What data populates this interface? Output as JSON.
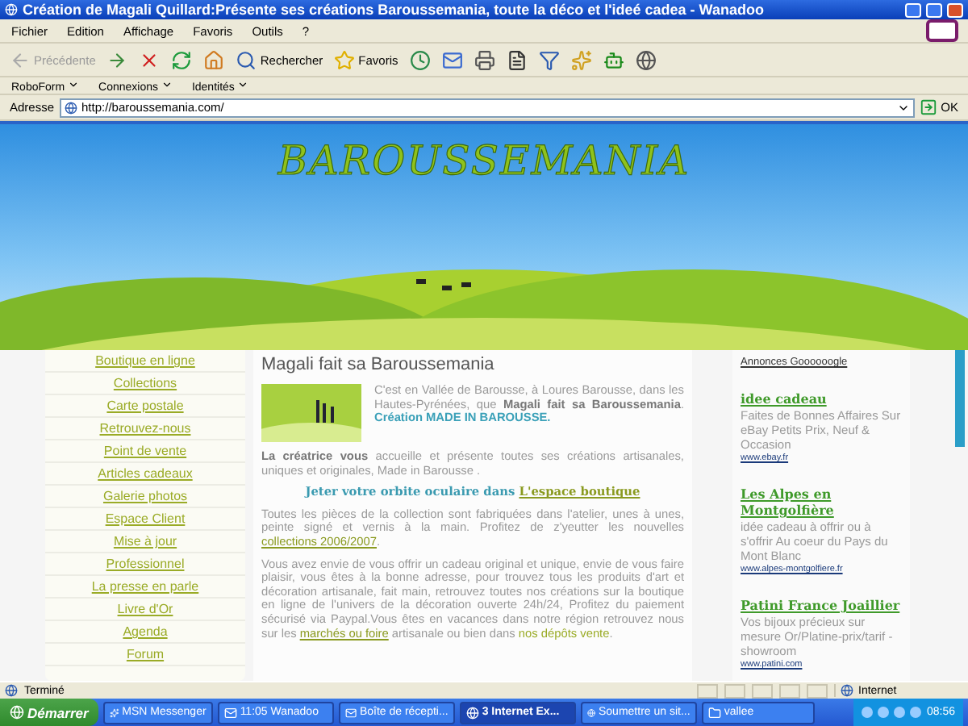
{
  "window": {
    "title": "Création de Magali Quillard:Présente ses créations Baroussemania, toute la déco et l'ideé cadea - Wanadoo"
  },
  "menu": [
    "Fichier",
    "Edition",
    "Affichage",
    "Favoris",
    "Outils",
    "?"
  ],
  "toolbar": [
    {
      "kind": "back",
      "label": "Précédente",
      "disabled": true
    },
    {
      "kind": "forward",
      "disabled": false
    },
    {
      "kind": "stop"
    },
    {
      "kind": "refresh"
    },
    {
      "kind": "home"
    },
    {
      "kind": "search",
      "label": "Rechercher"
    },
    {
      "kind": "favorites",
      "label": "Favoris"
    },
    {
      "kind": "history"
    },
    {
      "kind": "mail"
    },
    {
      "kind": "print"
    },
    {
      "kind": "edit"
    },
    {
      "kind": "filter"
    },
    {
      "kind": "messenger"
    },
    {
      "kind": "robot"
    },
    {
      "kind": "bag"
    }
  ],
  "links_bar": [
    "RoboForm",
    "Connexions",
    "Identités"
  ],
  "address": {
    "label": "Adresse",
    "value": "http://baroussemania.com/",
    "go": "OK"
  },
  "page": {
    "site_title": "BAROUSSEMANIA",
    "nav": [
      {
        "label": "Boutique en ligne"
      },
      {
        "label": "Collections"
      },
      {
        "label": "Carte postale"
      },
      {
        "label": "Retrouvez-nous"
      },
      {
        "label": "Point de vente"
      },
      {
        "label": "Articles cadeaux"
      },
      {
        "label": "Galerie photos"
      },
      {
        "label": "Espace Client"
      },
      {
        "label": "Mise à jour"
      },
      {
        "label": "Professionnel"
      },
      {
        "label": "La presse en parle"
      },
      {
        "label": "Livre d'Or"
      },
      {
        "label": "Agenda"
      },
      {
        "label": "Forum"
      }
    ],
    "heading": "Magali fait sa Baroussemania",
    "paragraphs": [
      [
        {
          "kind": "plain",
          "text": "C'est en Vallée de Barousse, à Loures Barousse, dans les Hautes-Pyrénées, que "
        },
        {
          "kind": "bold",
          "text": "Magali fait sa Baroussemania"
        },
        {
          "kind": "plain",
          "text": ". "
        },
        {
          "kind": "highlight",
          "text": "Création MADE IN BAROUSSE."
        }
      ],
      [
        {
          "kind": "bold",
          "text": "La créatrice vous"
        },
        {
          "kind": "plain",
          "text": " accueille et présente toutes ses créations artisanales, uniques et originales, Made in Barousse ."
        }
      ],
      [
        {
          "kind": "serif",
          "text": "Jeter votre orbite oculaire dans "
        },
        {
          "kind": "link",
          "text": "L'espace boutique"
        }
      ],
      [
        {
          "kind": "plain",
          "text": "Toutes les pièces de la collection sont fabriquées dans l'atelier, unes à unes, peinte signé et vernis à la main. Profitez de z'yeutter les nouvelles"
        },
        {
          "kind": "link",
          "text": " collections 2006/2007"
        },
        {
          "kind": "plain",
          "text": "."
        }
      ],
      [
        {
          "kind": "plain",
          "text": "Vous avez envie de vous offrir un cadeau original et unique, envie de vous faire plaisir, vous êtes à la bonne adresse, pour trouvez tous les produits d'art et décoration artisanale, fait main, retrouvez toutes nos créations sur la boutique en ligne de l'univers de la décoration ouverte 24h/24, Profitez du paiement sécurisé via Paypal.Vous êtes en vacances dans notre région retrouvez nous sur les "
        },
        {
          "kind": "link",
          "text": "marchés ou foire"
        },
        {
          "kind": "plain",
          "text": " artisanale ou bien dans "
        },
        {
          "kind": "highlight2",
          "text": "nos dépôts vente"
        },
        {
          "kind": "plain",
          "text": "."
        }
      ]
    ],
    "ads_title": "Annonces Goooooogle",
    "ads": [
      {
        "title": "idee cadeau",
        "text": "Faites de Bonnes Affaires Sur eBay Petits Prix, Neuf & Occasion",
        "url": "www.ebay.fr"
      },
      {
        "title": "Les Alpes en Montgolfière",
        "text": "idée cadeau à offrir ou à s'offrir Au coeur du Pays du Mont Blanc",
        "url": "www.alpes-montgolfiere.fr"
      },
      {
        "title": "Patini France Joaillier",
        "text": "Vos bijoux précieux sur mesure Or/Platine-prix/tarif -showroom",
        "url": "www.patini.com"
      }
    ]
  },
  "status_bar": {
    "text": "Terminé",
    "zone": "Internet"
  },
  "taskbar": {
    "start": "Démarrer",
    "items": [
      {
        "label": "MSN Messenger",
        "kind": "msn",
        "selected": false
      },
      {
        "label": "11:05 Wanadoo",
        "kind": "wanadoo",
        "selected": false
      },
      {
        "label": "Boîte de récepti...",
        "kind": "mail",
        "selected": false
      },
      {
        "label": "3 Internet Ex...",
        "kind": "ie",
        "selected": true
      },
      {
        "label": "Soumettre un sit...",
        "kind": "firefox",
        "selected": false
      },
      {
        "label": "vallee",
        "kind": "folder",
        "selected": false
      }
    ],
    "clock": "08:56"
  }
}
